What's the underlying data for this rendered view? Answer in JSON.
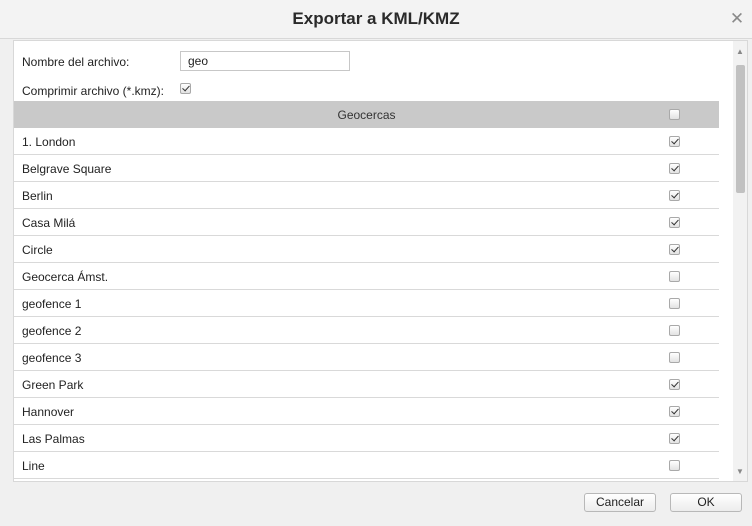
{
  "dialog": {
    "title": "Exportar a KML/KMZ",
    "close_icon": "close-icon"
  },
  "form": {
    "filename_label": "Nombre del archivo:",
    "filename_value": "geo",
    "compress_label": "Comprimir archivo (*.kmz):",
    "compress_checked": true
  },
  "table": {
    "header": "Geocercas",
    "select_all_checked": false,
    "rows": [
      {
        "name": "1. London",
        "checked": true
      },
      {
        "name": "Belgrave Square",
        "checked": true
      },
      {
        "name": "Berlin",
        "checked": true
      },
      {
        "name": "Casa Milá",
        "checked": true
      },
      {
        "name": "Circle",
        "checked": true
      },
      {
        "name": "Geocerca Ámst.",
        "checked": false
      },
      {
        "name": "geofence 1",
        "checked": false
      },
      {
        "name": "geofence 2",
        "checked": false
      },
      {
        "name": "geofence 3",
        "checked": false
      },
      {
        "name": "Green Park",
        "checked": true
      },
      {
        "name": "Hannover",
        "checked": true
      },
      {
        "name": "Las Palmas",
        "checked": true
      },
      {
        "name": "Line",
        "checked": false
      }
    ]
  },
  "buttons": {
    "cancel": "Cancelar",
    "ok": "OK"
  }
}
